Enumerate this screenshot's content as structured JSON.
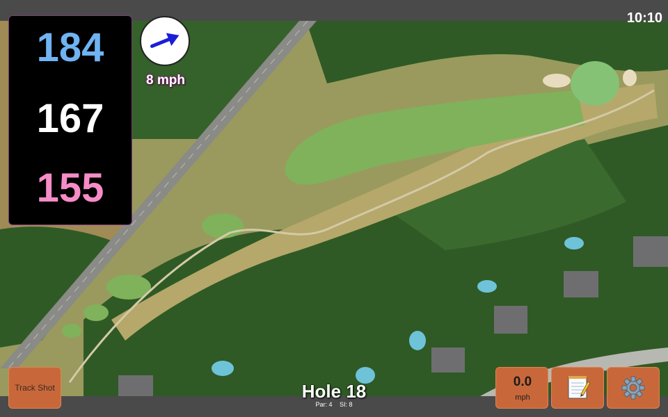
{
  "status": {
    "clock": "10:10"
  },
  "distances": {
    "back": "184",
    "middle": "167",
    "front": "155"
  },
  "wind": {
    "speed": "8 mph",
    "direction_icon": "arrow-east-northeast-icon"
  },
  "hole": {
    "title": "Hole 18",
    "par": "Par: 4",
    "stroke_index": "SI: 8"
  },
  "buttons": {
    "track_shot": "Track Shot",
    "speed_value": "0.0",
    "speed_unit": "mph",
    "notes_icon": "notepad-icon",
    "settings_icon": "gear-icon"
  },
  "colors": {
    "back_distance": "#6fb3f2",
    "middle_distance": "#ffffff",
    "front_distance": "#f58cc7",
    "button": "#c8683a",
    "fairway": "#7fb25b",
    "green": "#86c276",
    "bunker": "#e8dcc0",
    "trees": "#2f5a25",
    "road": "#8a8a86"
  }
}
